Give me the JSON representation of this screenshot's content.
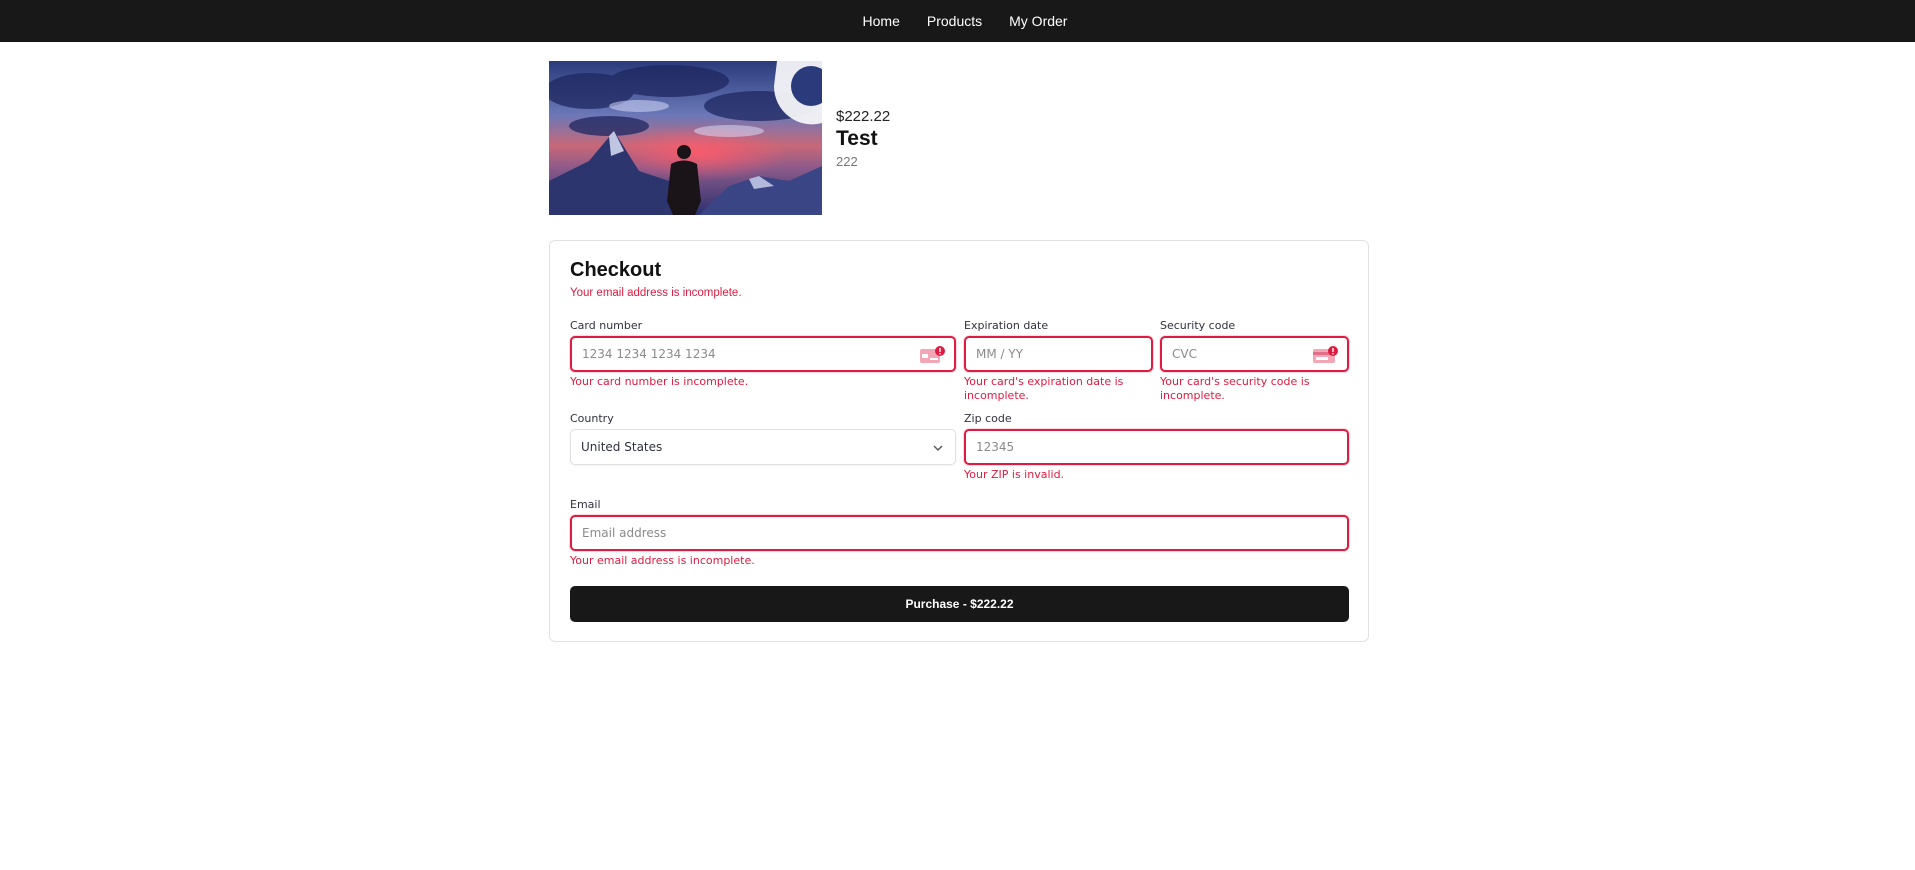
{
  "nav": {
    "items": [
      "Home",
      "Products",
      "My Order"
    ]
  },
  "product": {
    "price": "$222.22",
    "title": "Test",
    "quantity": "222"
  },
  "checkout": {
    "title": "Checkout",
    "top_error": "Your email address is incomplete.",
    "card_number": {
      "label": "Card number",
      "placeholder": "1234 1234 1234 1234",
      "error": "Your card number is incomplete."
    },
    "expiration": {
      "label": "Expiration date",
      "placeholder": "MM / YY",
      "error": "Your card's expiration date is incomplete."
    },
    "security": {
      "label": "Security code",
      "placeholder": "CVC",
      "error": "Your card's security code is incomplete."
    },
    "country": {
      "label": "Country",
      "value": "United States"
    },
    "zip": {
      "label": "Zip code",
      "placeholder": "12345",
      "error": "Your ZIP is invalid."
    },
    "email": {
      "label": "Email",
      "placeholder": "Email address",
      "error": "Your email address is incomplete."
    },
    "purchase_label": "Purchase - $222.22"
  },
  "colors": {
    "error": "#df1b41",
    "navbar": "#181818",
    "button": "#181818"
  }
}
